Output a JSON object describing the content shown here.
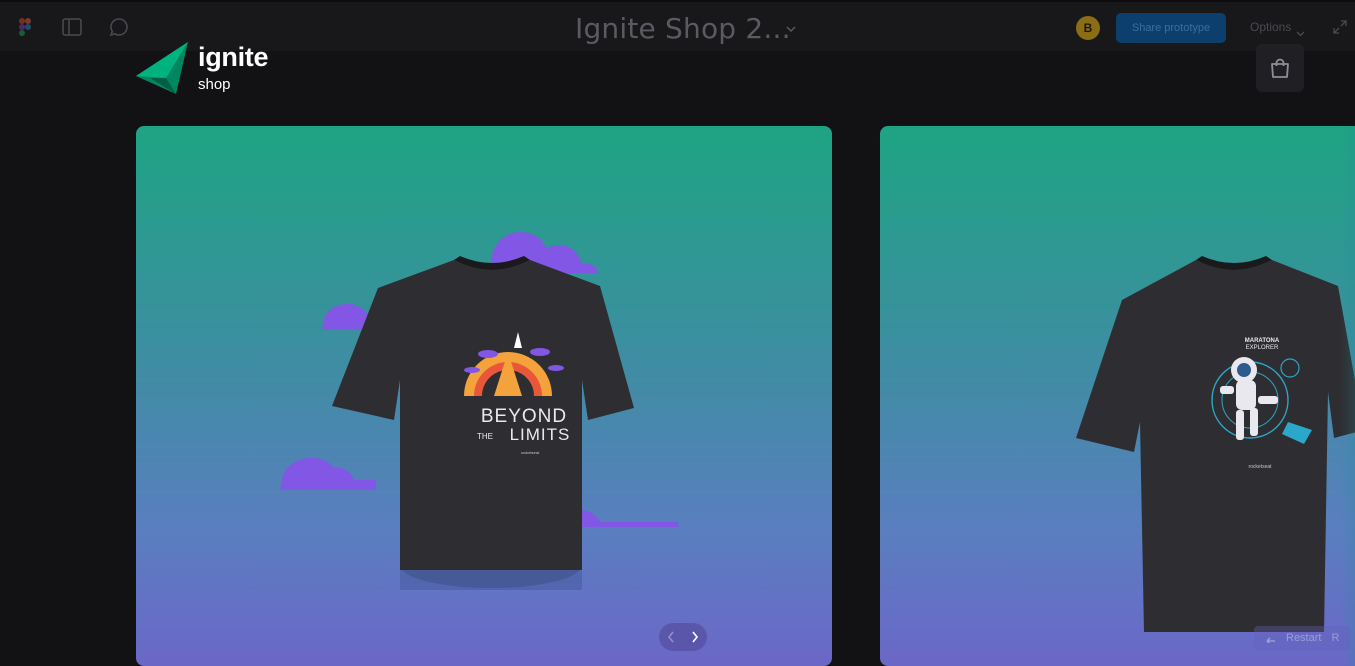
{
  "toolbar": {
    "icons": [
      "figma-logo-icon",
      "sidebar-panel-icon",
      "comment-icon"
    ],
    "title": "Ignite Shop 2...",
    "avatar_initial": "B",
    "share_label": "Share prototype",
    "options_label": "Options",
    "expand_icon": "expand-icon"
  },
  "header": {
    "logo_word": "ignite",
    "logo_sub": "shop",
    "logo_icon": "ignite-triangle-logo",
    "cart_icon": "shopping-bag-icon"
  },
  "products": [
    {
      "name_on_shirt_top": "BEYOND",
      "name_on_shirt_the": "THE",
      "name_on_shirt_bottom": "LIMITS",
      "brand_on_shirt": "rocketseat"
    },
    {
      "name_on_shirt_top": "MARATONA",
      "name_on_shirt_bottom": "EXPLORER",
      "brand_on_shirt": "rocketseat"
    }
  ],
  "carousel": {
    "prev_icon": "chevron-left-icon",
    "next_icon": "chevron-right-icon"
  },
  "restart": {
    "label": "Restart",
    "key": "R",
    "icon": "restart-arrow-icon"
  },
  "colors": {
    "brand_green": "#00b37e",
    "card_top": "#1ea483",
    "card_bottom": "#6b67c7",
    "share_button": "#0c3f6b"
  }
}
